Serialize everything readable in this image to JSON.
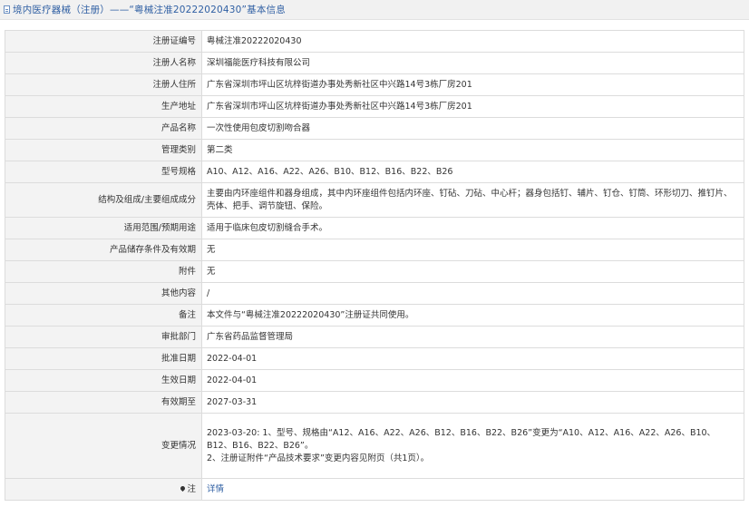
{
  "header": {
    "title": "境内医疗器械（注册）——“粤械注准20222020430”基本信息"
  },
  "rows": [
    {
      "label": "注册证编号",
      "value": "粤械注准20222020430"
    },
    {
      "label": "注册人名称",
      "value": "深圳福能医疗科技有限公司"
    },
    {
      "label": "注册人住所",
      "value": "广东省深圳市坪山区坑梓街道办事处秀新社区中兴路14号3栋厂房201"
    },
    {
      "label": "生产地址",
      "value": "广东省深圳市坪山区坑梓街道办事处秀新社区中兴路14号3栋厂房201"
    },
    {
      "label": "产品名称",
      "value": "一次性使用包皮切割吻合器"
    },
    {
      "label": "管理类别",
      "value": "第二类"
    },
    {
      "label": "型号规格",
      "value": "A10、A12、A16、A22、A26、B10、B12、B16、B22、B26"
    },
    {
      "label": "结构及组成/主要组成成分",
      "value": "主要由内环座组件和器身组成，其中内环座组件包括内环座、钉砧、刀砧、中心杆；器身包括钉、辅片、钉仓、钉筒、环形切刀、推钉片、壳体、把手、调节旋钮、保险。"
    },
    {
      "label": "适用范围/预期用途",
      "value": "适用于临床包皮切割缝合手术。"
    },
    {
      "label": "产品储存条件及有效期",
      "value": "无"
    },
    {
      "label": "附件",
      "value": "无"
    },
    {
      "label": "其他内容",
      "value": "/"
    },
    {
      "label": "备注",
      "value": "本文件与“粤械注准20222020430”注册证共同使用。"
    },
    {
      "label": "审批部门",
      "value": "广东省药品监督管理局"
    },
    {
      "label": "批准日期",
      "value": "2022-04-01"
    },
    {
      "label": "生效日期",
      "value": "2022-04-01"
    },
    {
      "label": "有效期至",
      "value": "2027-03-31"
    },
    {
      "label": "变更情况",
      "value_line1": "2023-03-20: 1、型号、规格由“A12、A16、A22、A26、B12、B16、B22、B26”变更为“A10、A12、A16、A22、A26、B10、B12、B16、B22、B26”。",
      "value_line2": "2、注册证附件“产品技术要求”变更内容见附页（共1页）。"
    }
  ],
  "note": {
    "label": "注",
    "link": "详情"
  }
}
